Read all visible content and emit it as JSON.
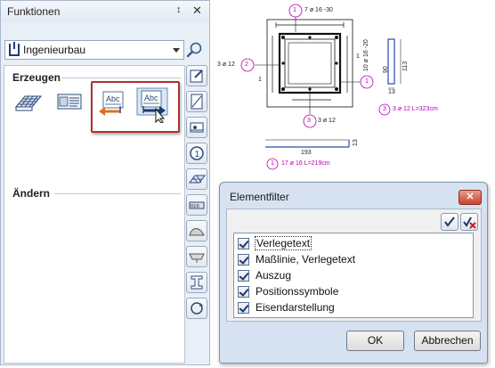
{
  "palette": {
    "title": "Funktionen",
    "pin_icon": "pin-icon",
    "close_icon": "close-icon",
    "combo_value": "Ingenieurbau",
    "sections": {
      "create": "Erzeugen",
      "modify": "Ändern"
    },
    "tools": [
      "reinforcement-mesh-icon",
      "bar-schedule-icon",
      "label-text-left-icon",
      "label-text-right-icon"
    ],
    "side_tabs": [
      "edit-icon",
      "area-icon",
      "section-icon",
      "position-icon",
      "mesh-icon",
      "bar-icon",
      "shape-icon",
      "link-icon",
      "beam-icon",
      "rotate-icon"
    ]
  },
  "drawing": {
    "labels": {
      "top_pos": "1",
      "top_text": "7 ø 16 -30",
      "left_pos": "2",
      "left_text": "3 ø 12",
      "right_pos": "1",
      "right_text": "10 ø 16 -20",
      "bottom_pos": "3",
      "bottom_text": "3 ø 12",
      "dim_193": "193",
      "dim_13": "13",
      "detail_1_pos": "1",
      "detail_1_text": "17 ø 16 L=219cm",
      "detail_3_pos": "3",
      "detail_3_text": "3 ø 12 L=323cm",
      "dim_113": "113",
      "dim_90": "90",
      "dim_13b": "13",
      "left_1": "1",
      "right_1": "1"
    }
  },
  "dialog": {
    "title": "Elementfilter",
    "items": [
      {
        "label": "Verlegetext",
        "checked": true
      },
      {
        "label": "Maßlinie, Verlegetext",
        "checked": true
      },
      {
        "label": "Auszug",
        "checked": true
      },
      {
        "label": "Positionssymbole",
        "checked": true
      },
      {
        "label": "Eisendarstellung",
        "checked": true
      }
    ],
    "ok_label": "OK",
    "cancel_label": "Abbrechen"
  },
  "colors": {
    "highlight": "#b03030",
    "annotation": "#b000b0",
    "dialog_bg": "#d6e2f1"
  }
}
